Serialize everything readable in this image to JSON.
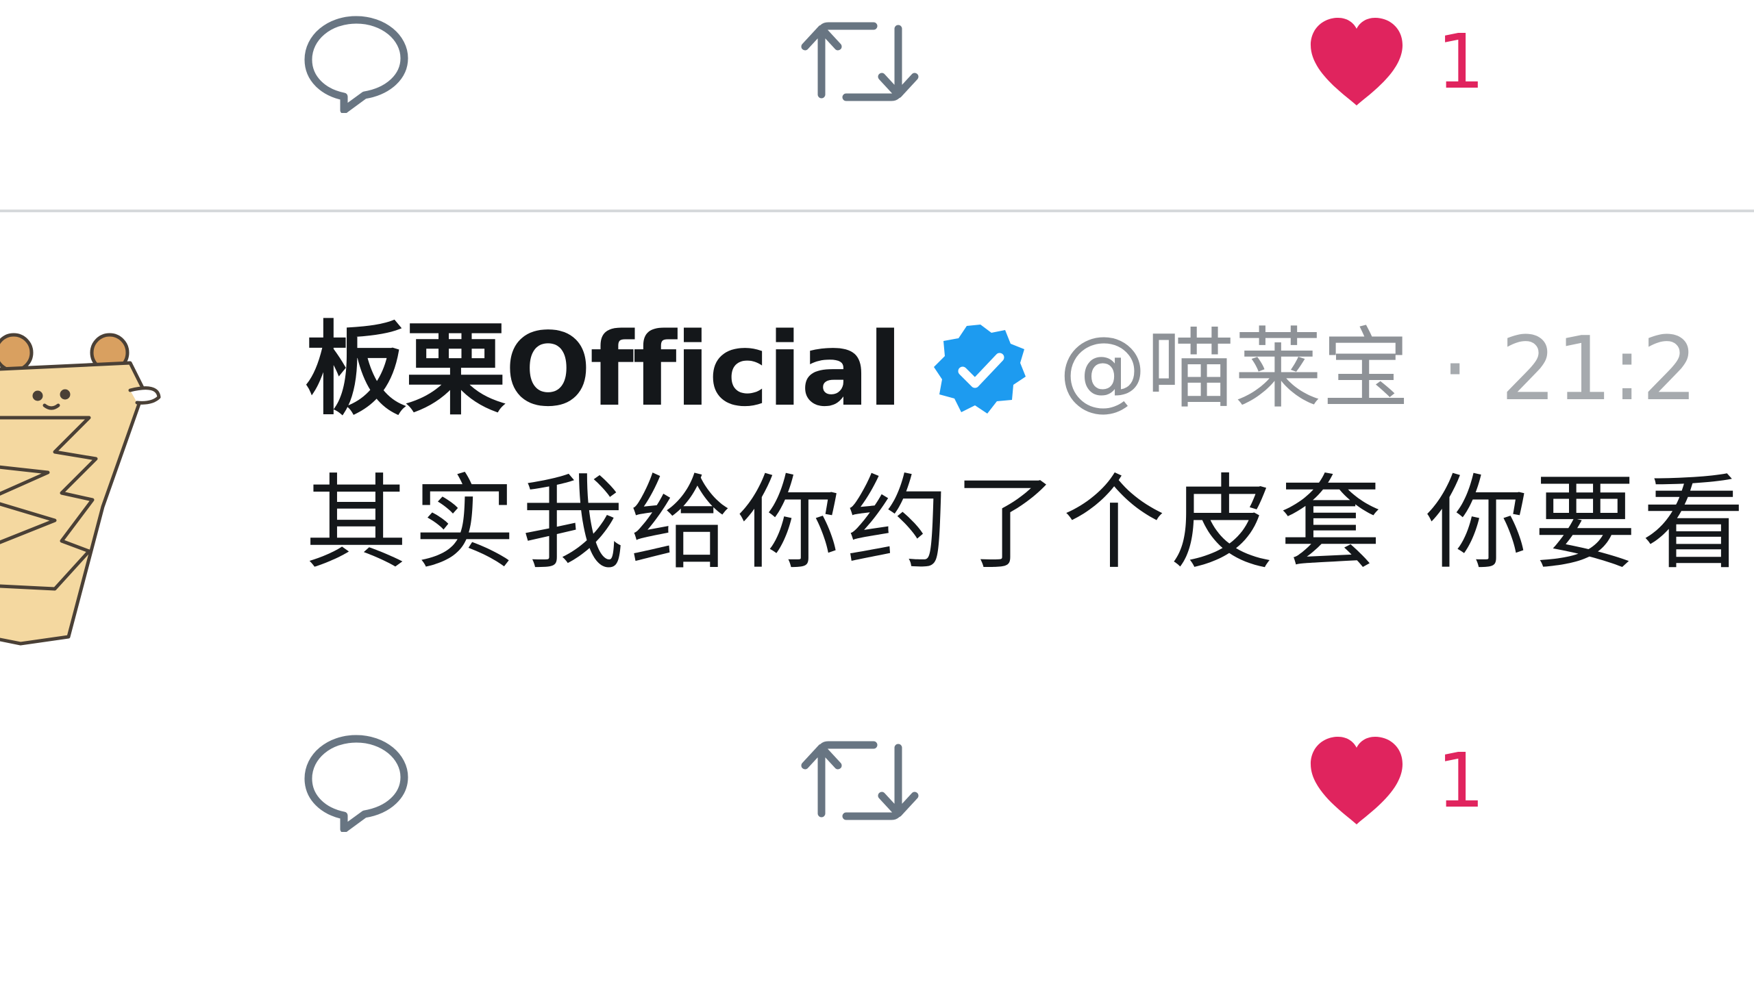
{
  "colors": {
    "like": "#e0245e",
    "icon_gray": "#687582",
    "verified": "#1d9bf0",
    "text": "#14171a",
    "muted": "#8e9297",
    "divider": "#d6d9db"
  },
  "top_actions": {
    "reply_icon": "comment-bubble-icon",
    "retweet_icon": "retweet-arrows-icon",
    "like_icon": "heart-filled-icon",
    "like_count": "1"
  },
  "tweet": {
    "avatar": "cartoon-character-avatar",
    "display_name": "板栗Official",
    "verified_icon": "verified-check-badge-icon",
    "handle": "@喵莱宝",
    "separator": "·",
    "timestamp": "21:2",
    "text": "其实我给你约了个皮套 你要看"
  },
  "bottom_actions": {
    "reply_icon": "comment-bubble-icon",
    "retweet_icon": "retweet-arrows-icon",
    "like_icon": "heart-filled-icon",
    "like_count": "1"
  }
}
